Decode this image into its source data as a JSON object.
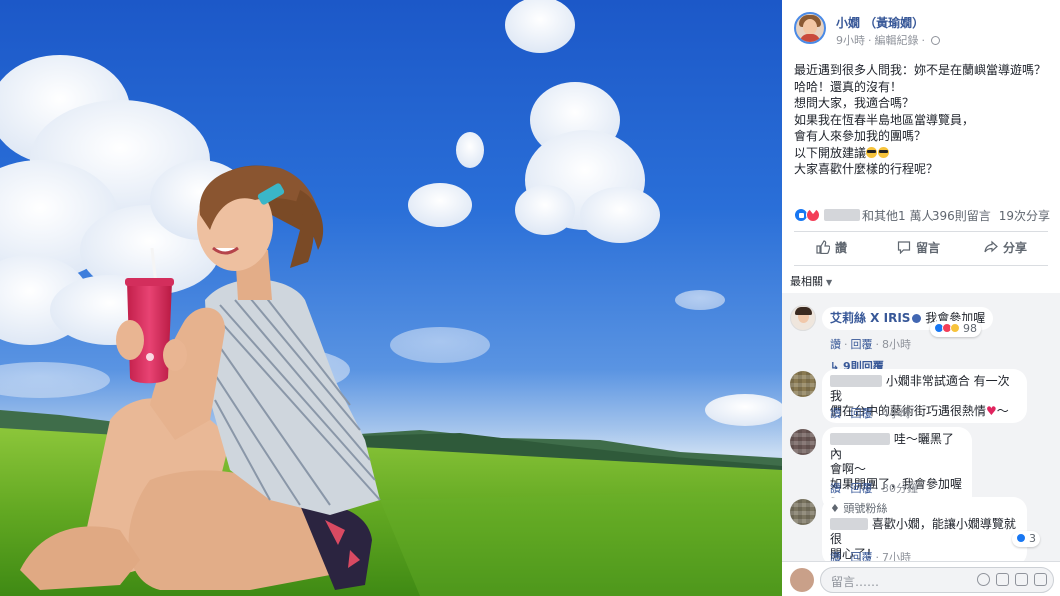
{
  "post": {
    "author": "小嫺 （黃瑜嫺）",
    "time": "9小時",
    "edit_history": "編輯紀錄",
    "lines": [
      "最近遇到很多人問我：妳不是在蘭嶼當導遊嗎？",
      "哈哈！還真的沒有！",
      "想問大家，我適合嗎？",
      "如果我在恆春半島地區當導覽員，",
      "會有人來參加我的團嗎？",
      "以下開放建議",
      "大家喜歡什麼樣的行程呢？"
    ]
  },
  "reactions": {
    "others_text": "和其他1 萬人",
    "comments_count": "396則留言",
    "shares_count": "19次分享"
  },
  "actions": {
    "like": "讚",
    "comment": "留言",
    "share": "分享"
  },
  "sort": {
    "label": "最相關"
  },
  "comments": [
    {
      "name": "艾莉絲 X IRIS",
      "text": "我會參加喔",
      "like": "讚",
      "reply": "回覆",
      "time": "8小時",
      "reaction_count": "98",
      "replies": "9則回覆"
    },
    {
      "text_line1": "小嫺非常試適合 有一次我",
      "text_line2": "們在台中的藝術街巧遇很熱情",
      "text_tail": "～",
      "like": "讚",
      "reply": "回覆",
      "time": "4小時"
    },
    {
      "text_line1": "哇～曬黑了內",
      "text_line2": "會啊～",
      "text_line3": "如果開團了，我會參加喔～",
      "like": "讚",
      "reply": "回覆",
      "time": "30分鐘"
    },
    {
      "badge": "頭號粉絲",
      "text_line1": "喜歡小嫺，能讓小嫺導覽就很",
      "text_line2": "開心了！",
      "like": "讚",
      "reply": "回覆",
      "time": "7小時",
      "reaction_count": "3"
    }
  ],
  "compose": {
    "placeholder": "留言……"
  }
}
